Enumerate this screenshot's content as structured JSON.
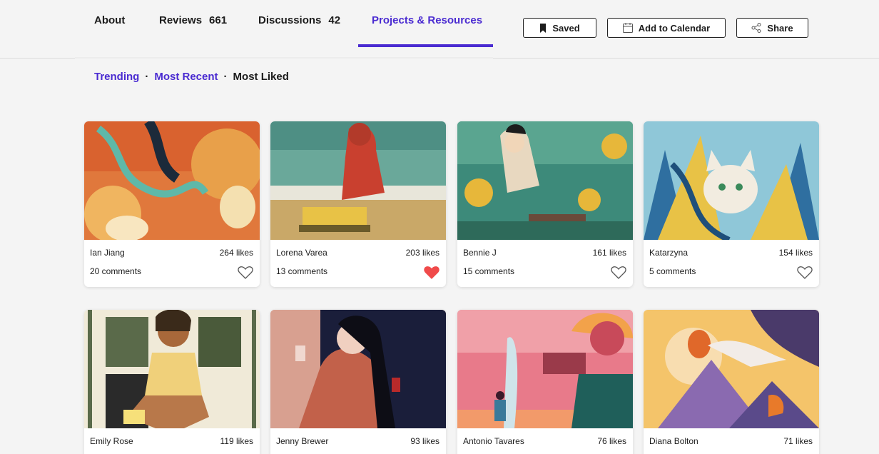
{
  "tabs": [
    {
      "label": "About",
      "count": ""
    },
    {
      "label": "Reviews",
      "count": "661"
    },
    {
      "label": "Discussions",
      "count": "42"
    },
    {
      "label": "Projects & Resources",
      "count": ""
    }
  ],
  "actions": {
    "saved": "Saved",
    "calendar": "Add to Calendar",
    "share": "Share"
  },
  "filters": [
    "Trending",
    "Most Recent",
    "Most Liked"
  ],
  "active_tab": "Projects & Resources",
  "active_filter": "Most Liked",
  "colors": {
    "accent": "#4a2bd1",
    "liked_heart": "#f04a4a"
  },
  "projects": [
    {
      "author": "Ian Jiang",
      "likes": "264 likes",
      "comments": "20 comments",
      "liked": false
    },
    {
      "author": "Lorena Varea",
      "likes": "203 likes",
      "comments": "13 comments",
      "liked": true
    },
    {
      "author": "Bennie J",
      "likes": "161 likes",
      "comments": "15 comments",
      "liked": false
    },
    {
      "author": "Katarzyna",
      "likes": "154 likes",
      "comments": "5 comments",
      "liked": false
    },
    {
      "author": "Emily Rose",
      "likes": "119 likes",
      "comments": "",
      "liked": false
    },
    {
      "author": "Jenny Brewer",
      "likes": "93 likes",
      "comments": "",
      "liked": false
    },
    {
      "author": "Antonio Tavares",
      "likes": "76 likes",
      "comments": "",
      "liked": false
    },
    {
      "author": "Diana Bolton",
      "likes": "71 likes",
      "comments": "",
      "liked": false
    }
  ]
}
